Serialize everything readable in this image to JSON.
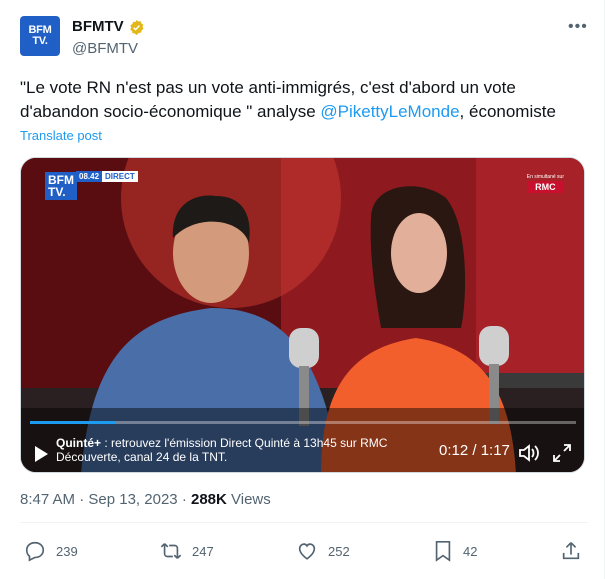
{
  "author": {
    "name": "BFMTV",
    "handle": "@BFMTV",
    "avatar_text_1": "BFM",
    "avatar_text_2": "TV."
  },
  "tweet": {
    "text_main": "\"Le vote RN n'est pas un vote anti-immigrés, c'est d'abord un vote d'abandon socio-économique \" analyse ",
    "mention": "@PikettyLeMonde",
    "text_end": ", économiste",
    "translate_label": "Translate post"
  },
  "video": {
    "logo_1": "BFM",
    "logo_2": "TV.",
    "live_time": "08.42",
    "live_label": "DIRECT",
    "rmc_small": "En simultané sur",
    "rmc_label": "RMC",
    "caption_brand": "Quinté+",
    "caption_line1": " : retrouvez l'émission Direct Quinté à 13h45 sur RMC",
    "caption_line2": "Découverte, canal 24 de la TNT.",
    "time": "0:12 / 1:17",
    "progress": 0.156
  },
  "meta": {
    "time": "8:47 AM",
    "date": "Sep 13, 2023",
    "views_count": "288K",
    "views_label": "Views",
    "sep": "·"
  },
  "actions": {
    "replies": "239",
    "reposts": "247",
    "likes": "252",
    "bookmarks": "42"
  },
  "colors": {
    "accent": "#1d9bf0",
    "text": "#0f1419",
    "muted": "#536471"
  }
}
